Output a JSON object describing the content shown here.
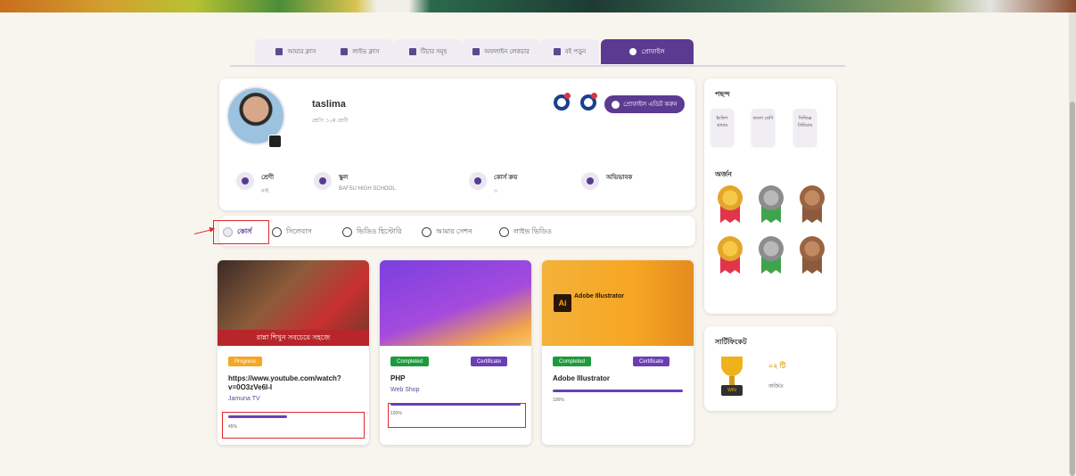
{
  "tabs": [
    {
      "label": "আমার ক্লাস"
    },
    {
      "label": "লাইভ ক্লাস"
    },
    {
      "label": "টিচার সমূহ"
    },
    {
      "label": "অফলাইন লেকচার"
    },
    {
      "label": "বই পড়ুন"
    },
    {
      "label": "প্রোফাইল"
    }
  ],
  "profile": {
    "name": "taslima",
    "subtitle": "শ্রেণি: ১০ম শ্রেণী",
    "edit_button": "প্রোফাইল এডিট করুন"
  },
  "stats": [
    {
      "label": "শ্রেণী",
      "value": "নাই"
    },
    {
      "label": "স্কুল",
      "value": "BAFSU HIGH SCHOOL"
    },
    {
      "label": "কোর্স ক্রয়",
      "value": "৩"
    },
    {
      "label": "অভিভাবক",
      "value": ""
    }
  ],
  "filters": [
    {
      "label": "কোর্স"
    },
    {
      "label": "সিলেবাস"
    },
    {
      "label": "ভিডিও হিস্টোরি"
    },
    {
      "label": "আমার সেশন"
    },
    {
      "label": "লাইভ ভিডিও"
    }
  ],
  "courses": [
    {
      "thumb_caption": "রান্না শিখুন সবচেয়ে সহজে",
      "status": "Progress",
      "status_color": "#f5a623",
      "certificate": "",
      "title": "https://www.youtube.com/watch?v=0O3zVe6I-I",
      "subtitle": "Jamuna TV",
      "progress_pct": 45,
      "progress_label": "45%"
    },
    {
      "thumb_caption": "",
      "status": "Completed",
      "status_color": "#1c9a3c",
      "certificate": "Certificate",
      "title": "PHP",
      "subtitle": "Web Shop",
      "progress_pct": 100,
      "progress_label": "100%"
    },
    {
      "thumb_caption": "",
      "status": "Completed",
      "status_color": "#1c9a3c",
      "certificate": "Certificate",
      "title": "Adobe Illustrator",
      "subtitle": "",
      "progress_pct": 100,
      "progress_label": "100%"
    }
  ],
  "thumb3": {
    "logo": "Ai",
    "title": "Adobe Illustrator"
  },
  "subjects": {
    "title": "পছন্দ",
    "items": [
      {
        "label": "ইংলিশ গ্রামার"
      },
      {
        "label": "বাংলা শ্রেণি"
      },
      {
        "label": "ফিজিক্স প্রিমিয়াম"
      }
    ]
  },
  "achievements": {
    "title": "অর্জন"
  },
  "certificates": {
    "title": "সার্টিফিকেট",
    "count": "০২ টি",
    "sublabel": "অর্জিত",
    "trophy_text": "WIN"
  },
  "colors": {
    "accent": "#5b3a92",
    "highlight": "#e0262d"
  }
}
